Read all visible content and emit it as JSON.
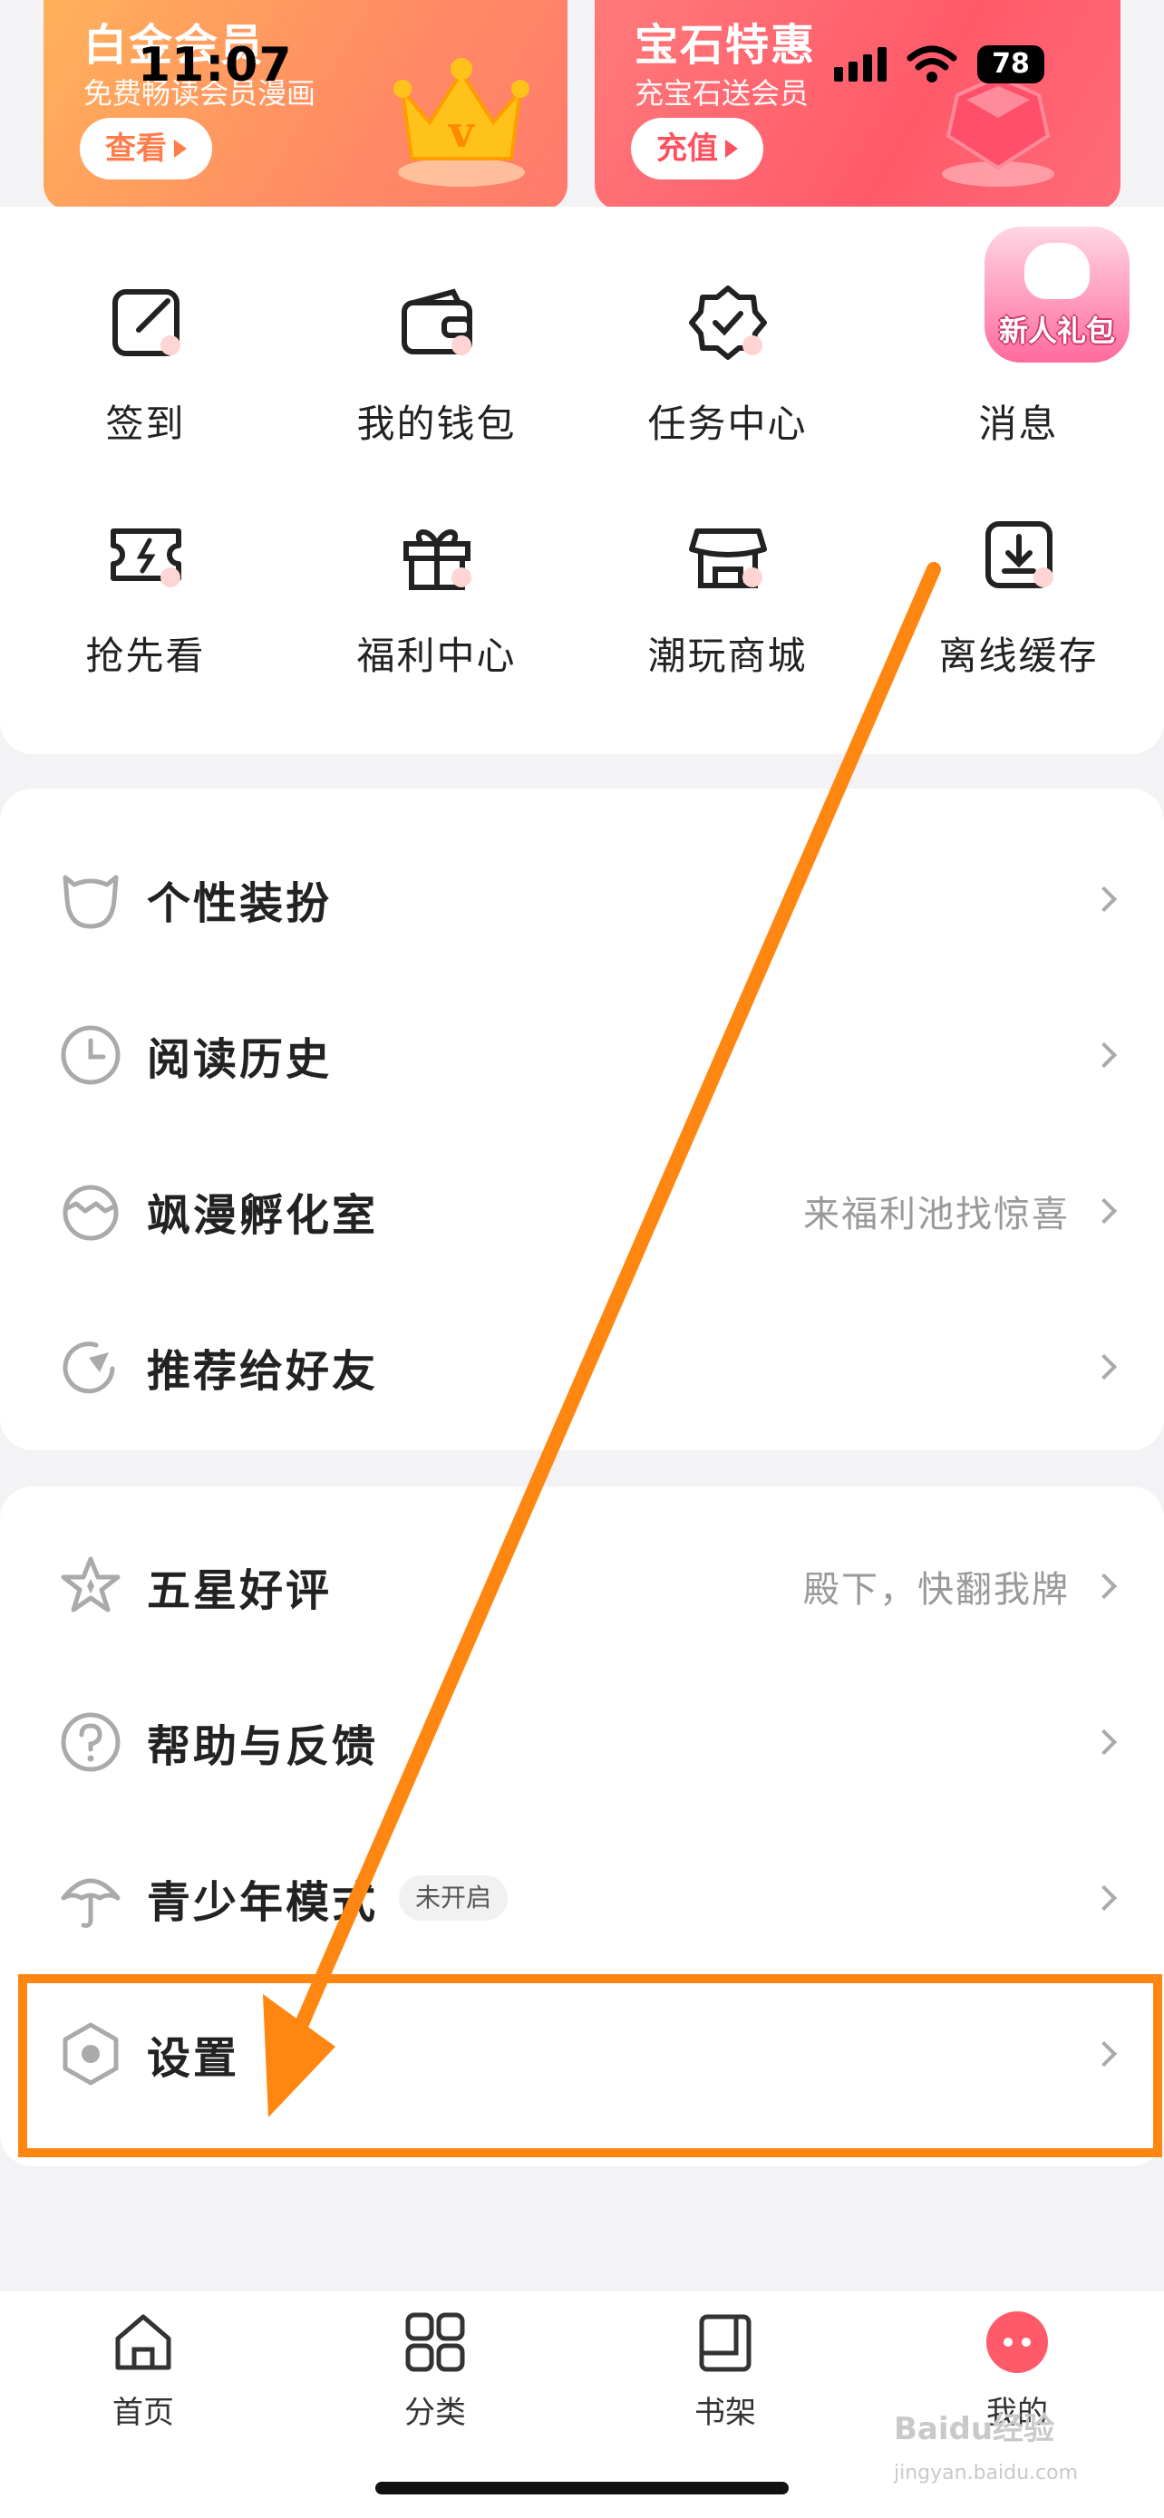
{
  "status_bar": {
    "time": "11:07",
    "battery": "78"
  },
  "banners": {
    "vip": {
      "title": "白金会员",
      "subtitle": "免费畅读会员漫画",
      "button": "查看"
    },
    "gem": {
      "title": "宝石特惠",
      "subtitle": "充宝石送会员",
      "button": "充值"
    }
  },
  "quick_menu": [
    {
      "label": "签到",
      "icon": "sign-in-icon"
    },
    {
      "label": "我的钱包",
      "icon": "wallet-icon"
    },
    {
      "label": "任务中心",
      "icon": "badge-check-icon"
    },
    {
      "label": "消息",
      "icon": "message-icon"
    },
    {
      "label": "抢先看",
      "icon": "ticket-icon"
    },
    {
      "label": "福利中心",
      "icon": "gift-icon"
    },
    {
      "label": "潮玩商城",
      "icon": "store-icon"
    },
    {
      "label": "离线缓存",
      "icon": "download-icon"
    }
  ],
  "gift_badge": {
    "label": "新人礼包"
  },
  "list_1": [
    {
      "label": "个性装扮",
      "hint": ""
    },
    {
      "label": "阅读历史",
      "hint": ""
    },
    {
      "label": "飒漫孵化室",
      "hint": "来福利池找惊喜"
    },
    {
      "label": "推荐给好友",
      "hint": ""
    }
  ],
  "list_2": [
    {
      "label": "五星好评",
      "hint": "殿下，快翻我牌"
    },
    {
      "label": "帮助与反馈",
      "hint": ""
    },
    {
      "label": "青少年模式",
      "hint": "",
      "tag": "未开启"
    },
    {
      "label": "设置",
      "hint": ""
    }
  ],
  "tabbar": [
    {
      "label": "首页",
      "icon": "home-icon"
    },
    {
      "label": "分类",
      "icon": "grid-icon"
    },
    {
      "label": "书架",
      "icon": "bookshelf-icon"
    },
    {
      "label": "我的",
      "icon": "profile-icon"
    }
  ],
  "watermark": {
    "text": "Baidu经验",
    "sub": "jingyan.baidu.com"
  },
  "colors": {
    "accent": "#ff8610",
    "active_tab": "#ff5a6a"
  }
}
